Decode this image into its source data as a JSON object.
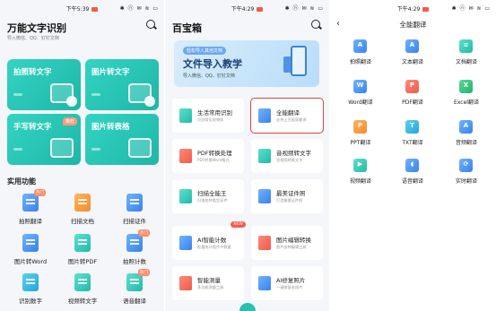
{
  "screen1": {
    "status_time": "下午5:39",
    "status_icons": "✱ ⓝ ✉ ≋ ▭",
    "title": "万能文字识别",
    "subtitle": "导入微信、QQ、钉钉文档",
    "cards": [
      {
        "label": "拍照转文字"
      },
      {
        "label": "图片转文字"
      },
      {
        "label": "手写转文字",
        "badge": "推荐"
      },
      {
        "label": "图片转表格"
      }
    ],
    "section_title": "实用功能",
    "functions": [
      {
        "label": "拍照翻译",
        "badge": "热门"
      },
      {
        "label": "扫描文档"
      },
      {
        "label": "扫描证件"
      },
      {
        "label": "图片转Word"
      },
      {
        "label": "图片转PDF"
      },
      {
        "label": "拍照计数",
        "badge": "热门"
      },
      {
        "label": "识别数字"
      },
      {
        "label": "视频转文字"
      },
      {
        "label": "语音翻译",
        "badge": "热门"
      }
    ]
  },
  "screen2": {
    "status_time": "下午4:29",
    "status_icons": "✱ ⓝ ✉ ≋ ▭",
    "title": "百宝箱",
    "banner": {
      "tag": "轻松导入其他文档",
      "title": "文件导入教学",
      "subtitle": "导入微信、QQ、钉钉文档"
    },
    "tools": [
      {
        "name": "生活常用识别",
        "desc": "识别常见的物体"
      },
      {
        "name": "全能翻译",
        "desc": "支持上百国家翻译"
      },
      {
        "name": "PDF转换处理",
        "desc": "PDF转换Word格式"
      },
      {
        "name": "音视频转文字",
        "desc": "音视频转换文字"
      },
      {
        "name": "扫描全能王",
        "desc": "扫描各种类型证件"
      },
      {
        "name": "最美证件照",
        "desc": "打造最美证件照"
      },
      {
        "name": "AI智能计数",
        "desc": "批量统计图片中数量",
        "badge": "NEW"
      },
      {
        "name": "图片编辑转换",
        "desc": "图片各种编辑工具"
      },
      {
        "name": "智能测量",
        "desc": "多功能测量工具"
      },
      {
        "name": "AI修复照片",
        "desc": "一键修复老照片"
      }
    ]
  },
  "screen3": {
    "status_time": "下午4:29",
    "status_icons": "✱ ⓝ ✉ ≋ ▭",
    "back_glyph": "‹",
    "title": "全能翻译",
    "items": [
      {
        "label": "拍照翻译",
        "glyph": "A"
      },
      {
        "label": "文本翻译",
        "glyph": "A"
      },
      {
        "label": "文档翻译",
        "glyph": "≡"
      },
      {
        "label": "Word翻译",
        "glyph": "W"
      },
      {
        "label": "PDF翻译",
        "glyph": "P"
      },
      {
        "label": "Excel翻译",
        "glyph": "X"
      },
      {
        "label": "PPT翻译",
        "glyph": "P"
      },
      {
        "label": "TXT翻译",
        "glyph": "T"
      },
      {
        "label": "音频翻译",
        "glyph": "A"
      },
      {
        "label": "视频翻译",
        "glyph": "▶"
      },
      {
        "label": "语音翻译",
        "glyph": "◖"
      },
      {
        "label": "实时翻译",
        "glyph": "⟳"
      }
    ]
  },
  "colors": {
    "teal": "#26c1b0",
    "highlight_border": "#e0403a",
    "badge_red": "#ff5a48",
    "badge_orange": "#ff8a65"
  }
}
